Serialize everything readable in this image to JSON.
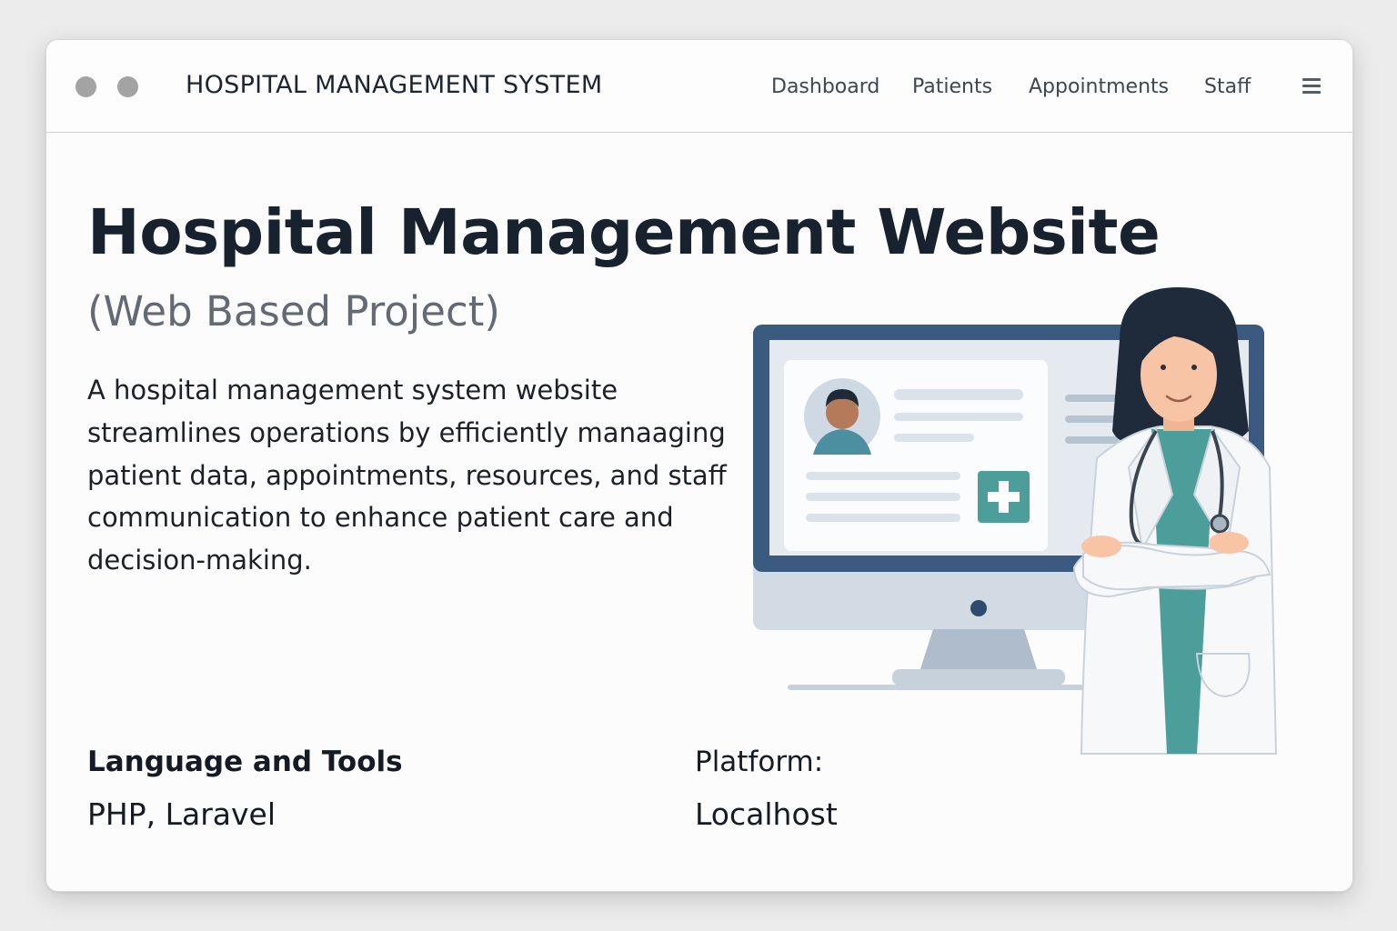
{
  "window": {
    "app_title": "HOSPITAL MANAGEMENT SYSTEM"
  },
  "nav": {
    "items": [
      {
        "label": "Dashboard"
      },
      {
        "label": "Patients"
      },
      {
        "label": "Appointments"
      },
      {
        "label": "Staff"
      }
    ],
    "menu_icon": "hamburger-menu-icon"
  },
  "hero": {
    "title": "Hospital Management Website",
    "subtitle": "(Web Based Project)",
    "description": "A hospital management system website streamlines operations by efficiently manaaging patient data, appointments, resources, and staff communication to enhance patient care and decision-making."
  },
  "details": {
    "language_label": "Language and Tools",
    "language_value": "PHP, Laravel",
    "platform_label": "Platform:",
    "platform_value": "Localhost"
  },
  "illustration": {
    "subject": "doctor-with-monitor-illustration",
    "accent_color": "#4c9e9b",
    "monitor_frame_color": "#3a5a80",
    "skin_color": "#f2b594"
  },
  "colors": {
    "title": "#18222f",
    "subtitle": "#636a73",
    "window_dots": "#a3a3a3"
  }
}
